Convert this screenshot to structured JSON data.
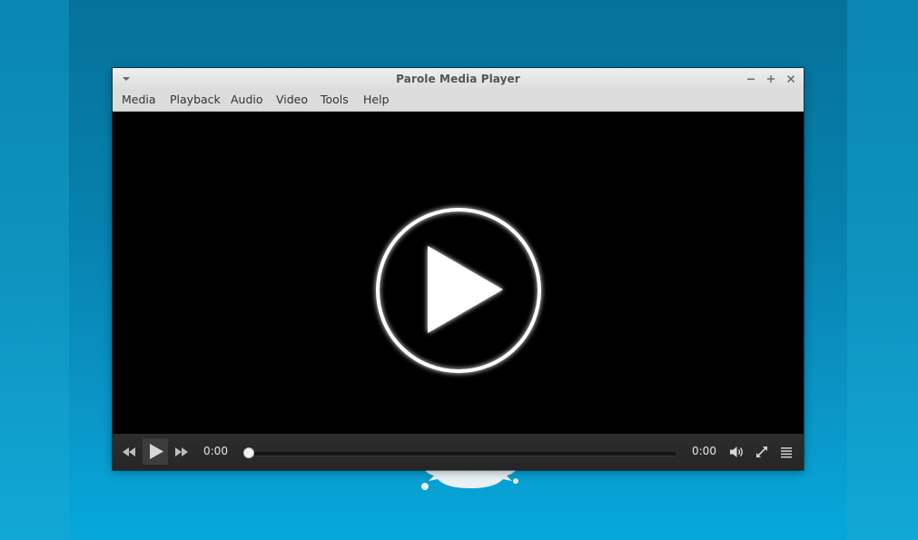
{
  "window": {
    "title": "Parole Media Player"
  },
  "menubar": {
    "items": [
      {
        "label": "Media"
      },
      {
        "label": "Playback"
      },
      {
        "label": "Audio"
      },
      {
        "label": "Video"
      },
      {
        "label": "Tools"
      },
      {
        "label": "Help"
      }
    ]
  },
  "controls": {
    "current_time": "0:00",
    "total_time": "0:00",
    "seek_progress": 0
  },
  "icons": {
    "window_menu": "chevron-down-icon",
    "minimize": "minimize-icon",
    "maximize": "maximize-icon",
    "close": "close-icon",
    "big_play": "play-circle-icon",
    "previous": "rewind-icon",
    "play": "play-icon",
    "next": "fast-forward-icon",
    "volume": "volume-icon",
    "fullscreen": "fullscreen-icon",
    "playlist": "playlist-icon"
  },
  "colors": {
    "desktop": "#0a86b3",
    "titlebar": "#dcdcdc",
    "video_bg": "#000000",
    "controls_bg": "#2b2b2b",
    "control_text": "#e6e6e6"
  }
}
